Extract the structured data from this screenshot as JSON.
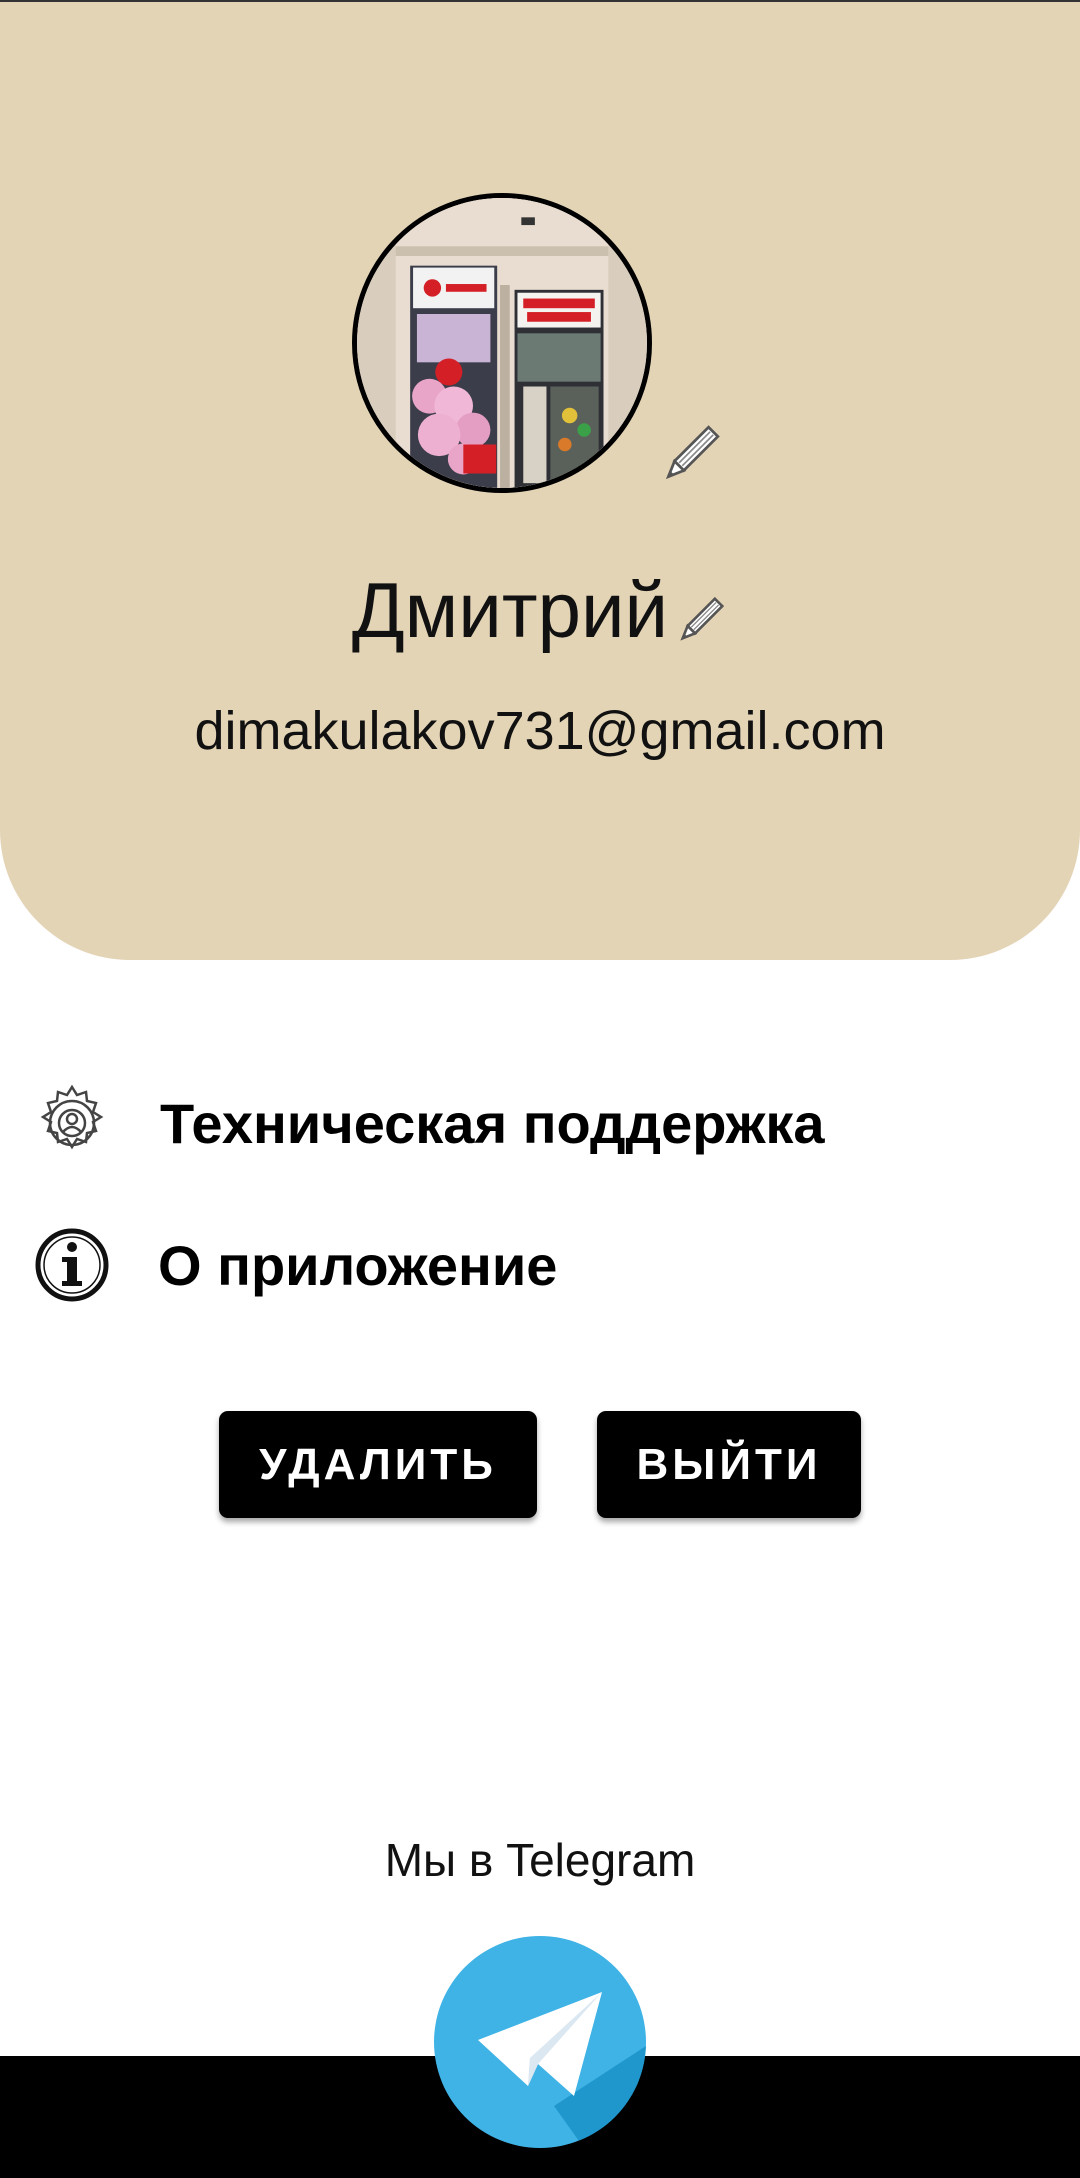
{
  "profile": {
    "name": "Дмитрий",
    "email": "dimakulakov731@gmail.com",
    "avatar_alt": "Магазин"
  },
  "menu": {
    "support": {
      "label": "Техническая поддержка",
      "icon": "gear-icon"
    },
    "about": {
      "label": "О приложение",
      "icon": "info-icon"
    }
  },
  "actions": {
    "delete_label": "УДАЛИТЬ",
    "logout_label": "ВЫЙТИ"
  },
  "footer": {
    "telegram_text": "Мы в Telegram",
    "telegram_icon": "telegram-icon"
  },
  "colors": {
    "header_bg": "#e4d4b6",
    "button_bg": "#000000",
    "telegram_blue": "#2ca5e0"
  }
}
